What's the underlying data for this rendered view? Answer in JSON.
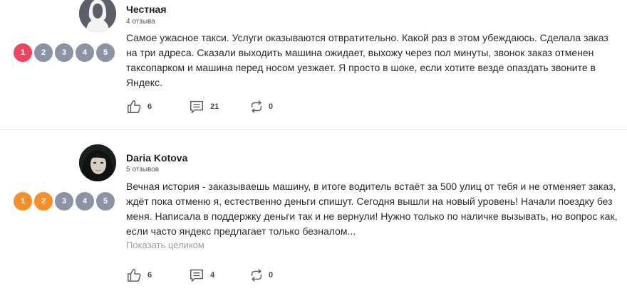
{
  "reviews": [
    {
      "author": "Честная",
      "review_count": "4 отзыва",
      "rating": {
        "options": [
          "1",
          "2",
          "3",
          "4",
          "5"
        ],
        "selected": 1,
        "active_color": "#f0455f",
        "inactive_color": "#8a94a6"
      },
      "text": "Самое ужасное такси. Услуги оказываются отвратительно. Какой раз в этом убеждаюсь. Сделала заказ на три адреса. Сказали выходить машина ожидает, выхожу через пол минуты, звонок заказ отменен таксопарком и машина перед носом уезжает. Я просто в шоке, если хотите везде опаздать звоните в Яндекс.",
      "likes": "6",
      "comments": "21",
      "reposts": "0"
    },
    {
      "author": "Daria Kotova",
      "review_count": "5 отзывов",
      "rating": {
        "options": [
          "1",
          "2",
          "3",
          "4",
          "5"
        ],
        "selected": 2,
        "active_color": "#f7902a",
        "inactive_color": "#8a94a6"
      },
      "text": "Вечная история - заказываешь машину, в итоге водитель встаёт за 500 улиц от тебя и не отменяет заказ, ждёт пока отменю я, естественно деньги спишут. Сегодня вышли на новый уровень! Начали поездку без меня. Написала в поддержку деньги так и не вернули! Нужно только по наличке вызывать, но вопрос как, если часто яндекс предлагает только безналом...",
      "expand_label": "Показать целиком",
      "likes": "6",
      "comments": "4",
      "reposts": "0"
    }
  ],
  "icons": {
    "like": "thumbs-up-icon",
    "comment": "comment-icon",
    "repost": "repost-icon"
  }
}
